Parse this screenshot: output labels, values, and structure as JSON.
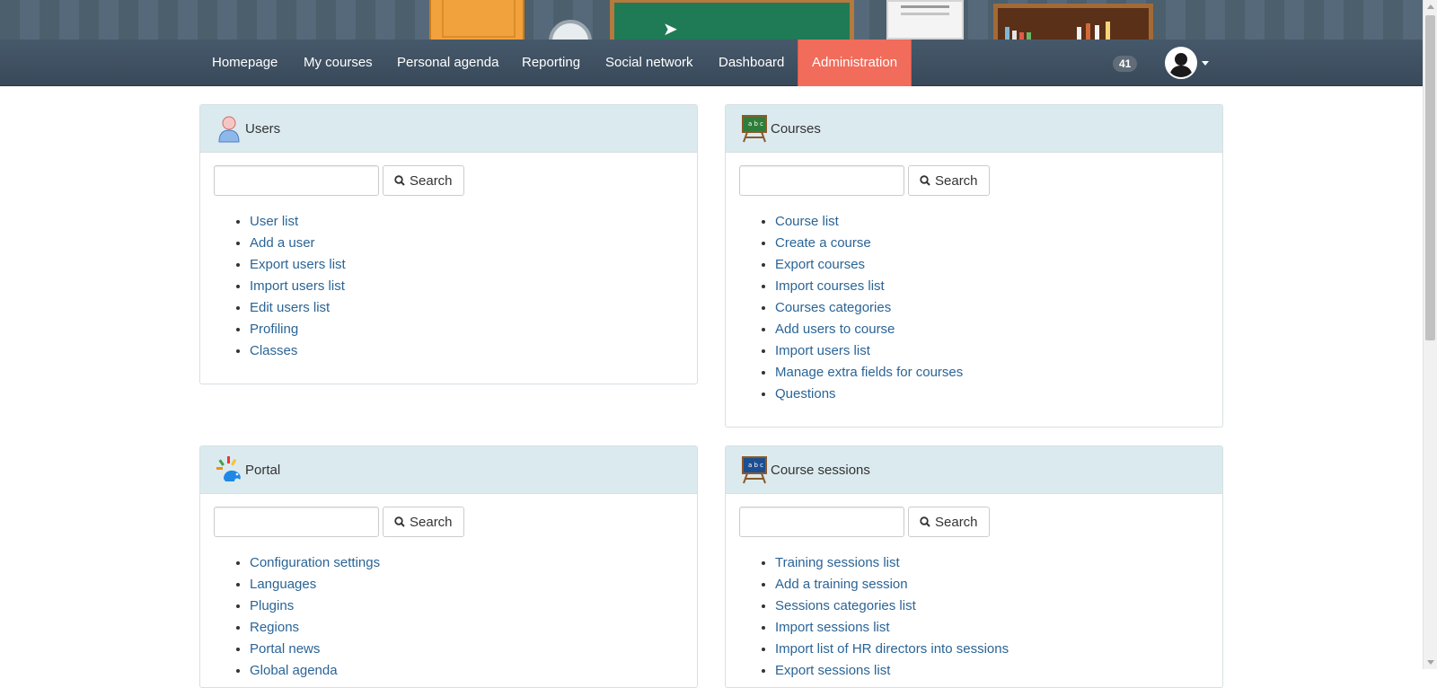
{
  "nav": {
    "items": [
      {
        "label": "Homepage"
      },
      {
        "label": "My courses"
      },
      {
        "label": "Personal agenda"
      },
      {
        "label": "Reporting"
      },
      {
        "label": "Social network"
      },
      {
        "label": "Dashboard"
      },
      {
        "label": "Administration",
        "active": true
      }
    ],
    "notification_count": "41"
  },
  "colors": {
    "navbar": "#3e5061",
    "active_tab": "#f16c5b",
    "panel_heading": "#dbeaef",
    "link": "#2a6496"
  },
  "panels": {
    "users": {
      "title": "Users",
      "icon": "user-icon",
      "search_label": "Search",
      "links": [
        "User list",
        "Add a user",
        "Export users list",
        "Import users list",
        "Edit users list",
        "Profiling",
        "Classes"
      ]
    },
    "courses": {
      "title": "Courses",
      "icon": "course-board-icon",
      "search_label": "Search",
      "links": [
        "Course list",
        "Create a course",
        "Export courses",
        "Import courses list",
        "Courses categories",
        "Add users to course",
        "Import users list",
        "Manage extra fields for courses",
        "Questions"
      ]
    },
    "portal": {
      "title": "Portal",
      "icon": "chamilo-logo-icon",
      "search_label": "Search",
      "links": [
        "Configuration settings",
        "Languages",
        "Plugins",
        "Regions",
        "Portal news",
        "Global agenda"
      ]
    },
    "sessions": {
      "title": "Course sessions",
      "icon": "session-board-icon",
      "search_label": "Search",
      "links": [
        "Training sessions list",
        "Add a training session",
        "Sessions categories list",
        "Import sessions list",
        "Import list of HR directors into sessions",
        "Export sessions list"
      ]
    }
  }
}
